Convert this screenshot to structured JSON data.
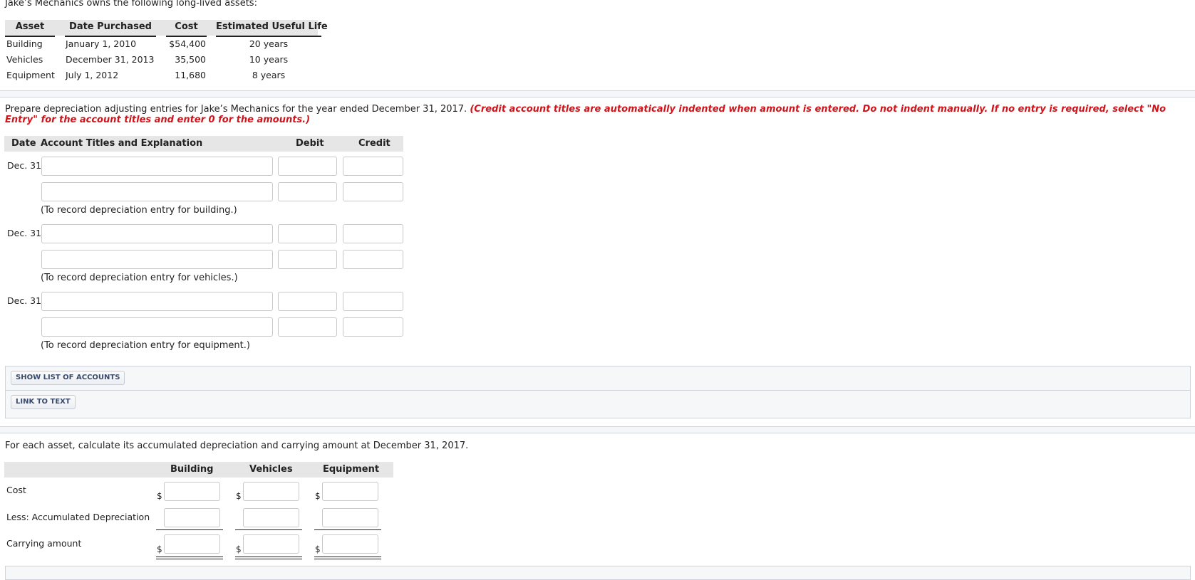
{
  "intro": "Jake’s Mechanics owns the following long-lived assets:",
  "assets_table": {
    "headers": [
      "Asset",
      "Date Purchased",
      "Cost",
      "Estimated Useful Life"
    ],
    "rows": [
      {
        "asset": "Building",
        "date": "January 1, 2010",
        "cost": "$54,400",
        "life": "20 years"
      },
      {
        "asset": "Vehicles",
        "date": "December 31, 2013",
        "cost": "35,500",
        "life": "10 years"
      },
      {
        "asset": "Equipment",
        "date": "July 1, 2012",
        "cost": "11,680",
        "life": "8 years"
      }
    ]
  },
  "journal": {
    "instruction": "Prepare depreciation adjusting entries for Jake’s Mechanics for the year ended December 31, 2017.",
    "instruction_note": "(Credit account titles are automatically indented when amount is entered. Do not indent manually. If no entry is required, select \"No Entry\" for the account titles and enter 0 for the amounts.)",
    "headers": {
      "date": "Date",
      "account": "Account Titles and Explanation",
      "debit": "Debit",
      "credit": "Credit"
    },
    "entries": [
      {
        "date": "Dec. 31",
        "lines": [
          {
            "account": "",
            "debit": "",
            "credit": ""
          },
          {
            "account": "",
            "debit": "",
            "credit": ""
          }
        ],
        "note": "(To record depreciation entry for building.)"
      },
      {
        "date": "Dec. 31",
        "lines": [
          {
            "account": "",
            "debit": "",
            "credit": ""
          },
          {
            "account": "",
            "debit": "",
            "credit": ""
          }
        ],
        "note": "(To record depreciation entry for vehicles.)"
      },
      {
        "date": "Dec. 31",
        "lines": [
          {
            "account": "",
            "debit": "",
            "credit": ""
          },
          {
            "account": "",
            "debit": "",
            "credit": ""
          }
        ],
        "note": "(To record depreciation entry for equipment.)"
      }
    ]
  },
  "tools": {
    "show_accounts_label": "SHOW LIST OF ACCOUNTS",
    "link_text_label": "LINK TO TEXT"
  },
  "carrying": {
    "instruction": "For each asset, calculate its accumulated depreciation and carrying amount at December 31, 2017.",
    "columns": [
      "Building",
      "Vehicles",
      "Equipment"
    ],
    "rows": [
      {
        "label": "Cost",
        "currency": "$",
        "values": [
          "",
          "",
          ""
        ]
      },
      {
        "label": "Less: Accumulated Depreciation",
        "currency": "",
        "values": [
          "",
          "",
          ""
        ]
      },
      {
        "label": "Carrying amount",
        "currency": "$",
        "values": [
          "",
          "",
          ""
        ]
      }
    ]
  }
}
